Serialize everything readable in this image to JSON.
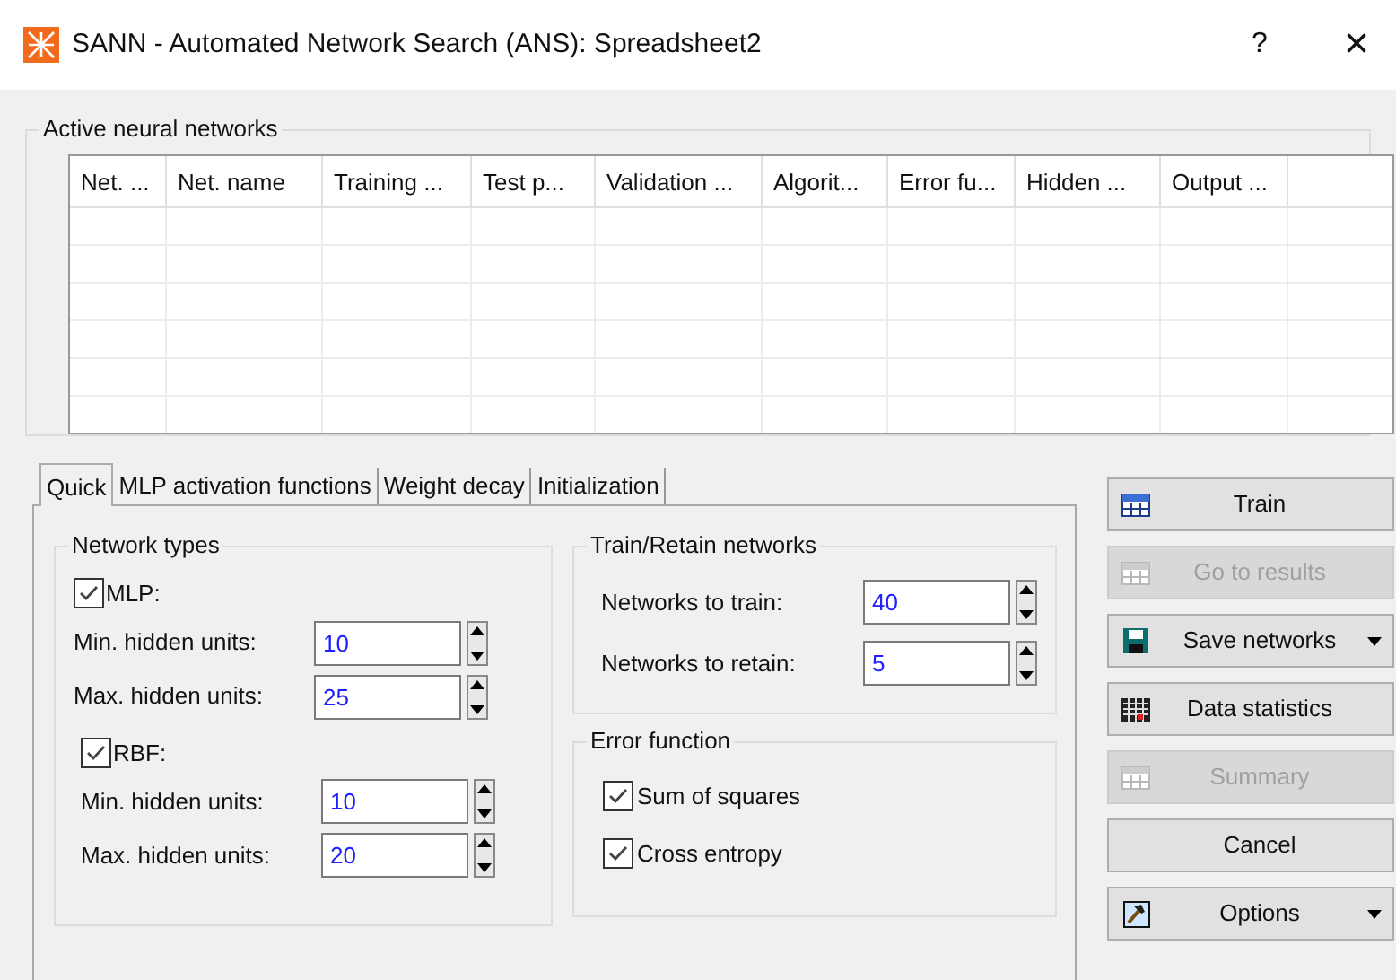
{
  "window": {
    "title": "SANN - Automated Network Search (ANS): Spreadsheet2",
    "help": "?",
    "close": "×"
  },
  "networks_group": {
    "title": "Active neural networks",
    "columns": [
      "Net. ...",
      "Net. name",
      "Training ...",
      "Test p...",
      "Validation ...",
      "Algorit...",
      "Error fu...",
      "Hidden ...",
      "Output ..."
    ]
  },
  "tabs": [
    {
      "label": "Quick",
      "selected": true
    },
    {
      "label": "MLP activation functions",
      "selected": false
    },
    {
      "label": "Weight decay",
      "selected": false
    },
    {
      "label": "Initialization",
      "selected": false
    }
  ],
  "network_types": {
    "title": "Network types",
    "types": [
      {
        "label": "MLP:",
        "checked": true,
        "fields": [
          {
            "label": "Min. hidden units:",
            "value": "10"
          },
          {
            "label": "Max. hidden units:",
            "value": "25"
          }
        ]
      },
      {
        "label": "RBF:",
        "checked": true,
        "fields": [
          {
            "label": "Min. hidden units:",
            "value": "10"
          },
          {
            "label": "Max. hidden units:",
            "value": "20"
          }
        ]
      }
    ]
  },
  "train_retain": {
    "title": "Train/Retain networks",
    "fields": [
      {
        "label": "Networks to train:",
        "value": "40"
      },
      {
        "label": "Networks to retain:",
        "value": "5"
      }
    ]
  },
  "error_function": {
    "title": "Error function",
    "options": [
      {
        "label": "Sum of squares",
        "checked": true
      },
      {
        "label": "Cross entropy",
        "checked": true
      }
    ]
  },
  "buttons": [
    {
      "label": "Train",
      "kind": "grid",
      "disabled": false,
      "dropdown": false
    },
    {
      "label": "Go to results",
      "kind": "grid",
      "disabled": true,
      "dropdown": false
    },
    {
      "label": "Save networks",
      "kind": "disk",
      "disabled": false,
      "dropdown": true
    },
    {
      "label": "Data statistics",
      "kind": "chart",
      "disabled": false,
      "dropdown": false
    },
    {
      "label": "Summary",
      "kind": "grid",
      "disabled": true,
      "dropdown": false
    },
    {
      "label": "Cancel",
      "kind": "plain",
      "disabled": false,
      "dropdown": false
    },
    {
      "label": "Options",
      "kind": "hammer",
      "disabled": false,
      "dropdown": true
    }
  ]
}
